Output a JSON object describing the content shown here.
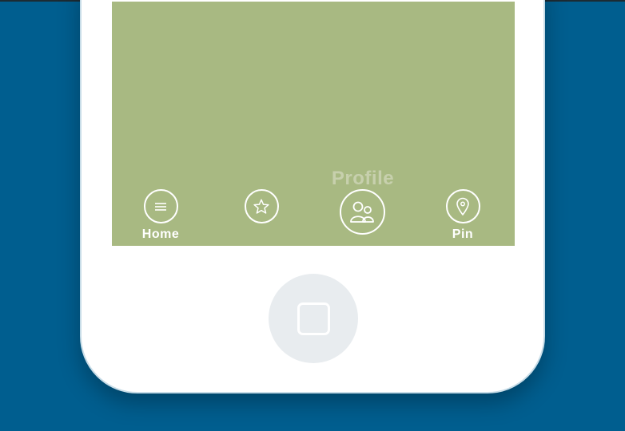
{
  "colors": {
    "background": "#005e8f",
    "screen": "#a8b982",
    "phone_body": "#ffffff",
    "home_button": "#e8ecef",
    "active_label": "#c7d0ad"
  },
  "nav": {
    "active_label": "Profile",
    "items": [
      {
        "icon": "menu-icon",
        "label": "Home"
      },
      {
        "icon": "star-icon",
        "label": ""
      },
      {
        "icon": "users-icon",
        "label": ""
      },
      {
        "icon": "map-pin-icon",
        "label": "Pin"
      }
    ]
  }
}
